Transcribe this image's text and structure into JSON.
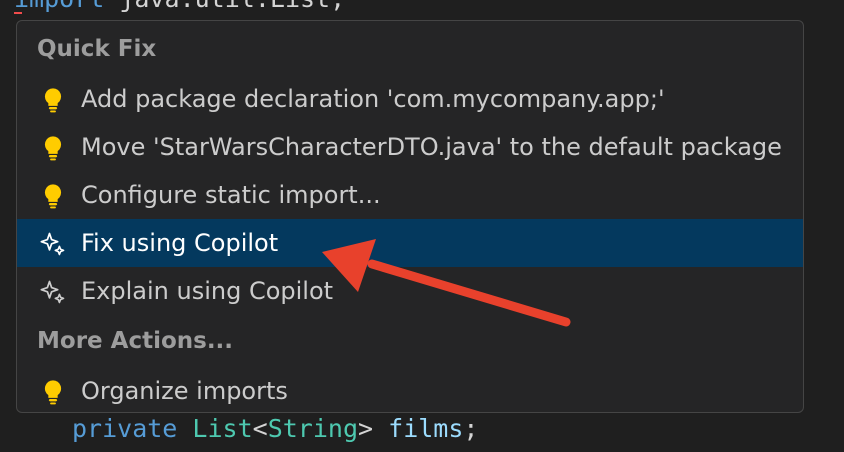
{
  "code": {
    "top_line": {
      "keyword": "import",
      "rest": "java.util.List;"
    },
    "bottom_line": {
      "keyword": "private",
      "type": "List",
      "lt": "<",
      "generic": "String",
      "gt": ">",
      "name": "films",
      "end": ";"
    }
  },
  "quickfix": {
    "header_quick_fix": "Quick Fix",
    "header_more_actions": "More Actions...",
    "items": [
      {
        "label": "Add package declaration 'com.mycompany.app;'",
        "icon": "lightbulb-icon"
      },
      {
        "label": "Move 'StarWarsCharacterDTO.java' to the default package",
        "icon": "lightbulb-icon"
      },
      {
        "label": "Configure static import...",
        "icon": "lightbulb-icon"
      },
      {
        "label": "Fix using Copilot",
        "icon": "sparkle-icon",
        "selected": true
      },
      {
        "label": "Explain using Copilot",
        "icon": "sparkle-icon"
      },
      {
        "label": "Organize imports",
        "icon": "lightbulb-icon"
      }
    ]
  },
  "colors": {
    "selection": "#04395e",
    "lightbulb": "#ffcc00",
    "annotation_arrow": "#e8412c"
  }
}
